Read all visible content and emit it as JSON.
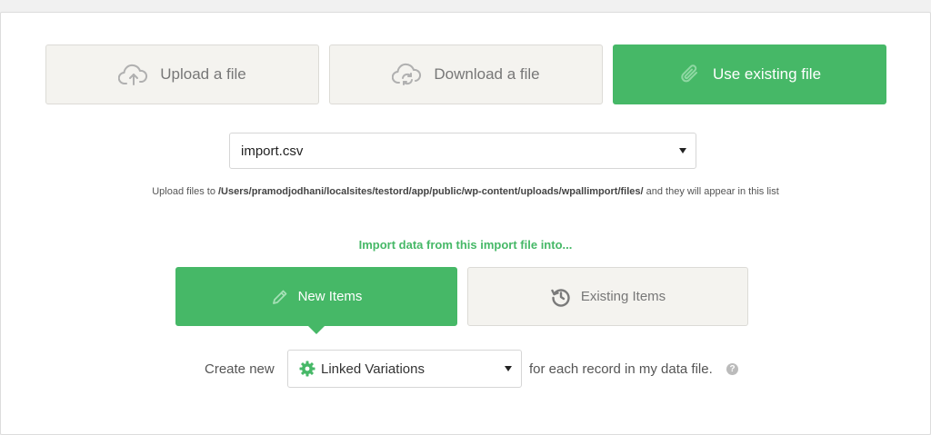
{
  "source_options": {
    "upload": {
      "label": "Upload a file",
      "icon": "cloud-upload-icon"
    },
    "download": {
      "label": "Download a file",
      "icon": "cloud-sync-icon"
    },
    "existing": {
      "label": "Use existing file",
      "icon": "paperclip-icon",
      "active": true
    }
  },
  "file_select": {
    "value": "import.csv"
  },
  "hint": {
    "prefix": "Upload files to ",
    "path": "/Users/pramodjodhani/localsites/testord/app/public/wp-content/uploads/wpallimport/files/",
    "suffix": " and they will appear in this list"
  },
  "import_heading": "Import data from this import file into...",
  "item_types": {
    "new": {
      "label": "New Items",
      "icon": "pencil-icon",
      "active": true
    },
    "existing": {
      "label": "Existing Items",
      "icon": "history-icon"
    }
  },
  "create_row": {
    "prefix": "Create new",
    "selected_type": "Linked Variations",
    "selected_icon": "gear-icon",
    "suffix": "for each record in my data file.",
    "help": "?"
  },
  "colors": {
    "accent": "#46b867",
    "neutral_bg": "#f4f3ef",
    "border": "#dcdbd6"
  }
}
